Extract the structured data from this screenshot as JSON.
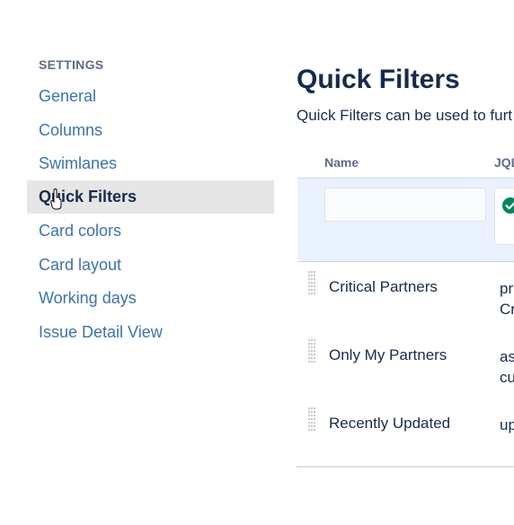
{
  "sidebar": {
    "heading": "SETTINGS",
    "items": [
      {
        "label": "General"
      },
      {
        "label": "Columns"
      },
      {
        "label": "Swimlanes"
      },
      {
        "label": "Quick Filters"
      },
      {
        "label": "Card colors"
      },
      {
        "label": "Card layout"
      },
      {
        "label": "Working days"
      },
      {
        "label": "Issue Detail View"
      }
    ]
  },
  "main": {
    "title": "Quick Filters",
    "description": "Quick Filters can be used to furt",
    "columns": {
      "name": "Name",
      "jql": "JQL"
    },
    "add_row": {
      "name_value": "",
      "jql_status": "valid"
    },
    "rows": [
      {
        "name": "Critical Partners",
        "jql_line1": "pr",
        "jql_line2": "Cr"
      },
      {
        "name": "Only My Partners",
        "jql_line1": "as",
        "jql_line2": "cu"
      },
      {
        "name": "Recently Updated",
        "jql_line1": "up",
        "jql_line2": ""
      }
    ]
  },
  "colors": {
    "link": "#3b73af",
    "active_bg": "#e6e6e6",
    "add_row_bg": "#ebf2ff",
    "success": "#00875a"
  }
}
